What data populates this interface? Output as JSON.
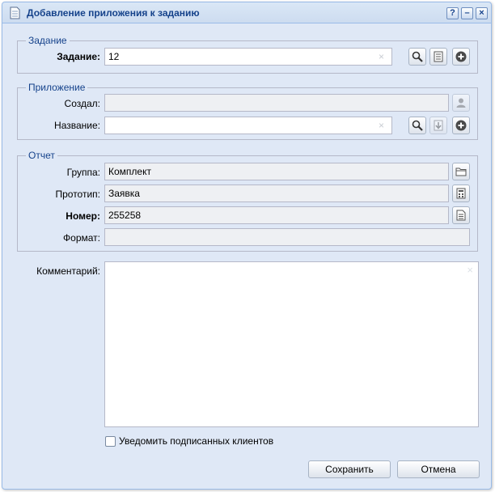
{
  "window": {
    "title": "Добавление приложения к заданию",
    "tools": {
      "help": "?",
      "minimize": "–",
      "close": "×"
    }
  },
  "task_section": {
    "legend": "Задание",
    "task": {
      "label": "Задание:",
      "value": "12"
    }
  },
  "attachment_section": {
    "legend": "Приложение",
    "created_by": {
      "label": "Создал:",
      "value": ""
    },
    "name": {
      "label": "Название:",
      "value": ""
    }
  },
  "report_section": {
    "legend": "Отчет",
    "group": {
      "label": "Группа:",
      "value": "Комплект"
    },
    "prototype": {
      "label": "Прототип:",
      "value": "Заявка"
    },
    "number": {
      "label": "Номер:",
      "value": "255258"
    },
    "format": {
      "label": "Формат:",
      "value": ""
    }
  },
  "comment": {
    "label": "Комментарий:",
    "value": "",
    "clear": "×"
  },
  "notify": {
    "label": "Уведомить подписанных клиентов",
    "checked": false
  },
  "buttons": {
    "save": "Сохранить",
    "cancel": "Отмена"
  },
  "combo_clear": "×",
  "icons": {
    "title": "document-icon",
    "search": "magnifier-icon",
    "details": "document-lines-icon",
    "add": "plus-circle-icon",
    "user": "user-icon",
    "download": "download-arrow-icon",
    "folder": "folder-icon",
    "calculator": "calculator-icon",
    "document": "document-icon"
  },
  "colors": {
    "window_bg": "#dfe8f6",
    "title_text": "#15428b",
    "border": "#99bbe8"
  }
}
